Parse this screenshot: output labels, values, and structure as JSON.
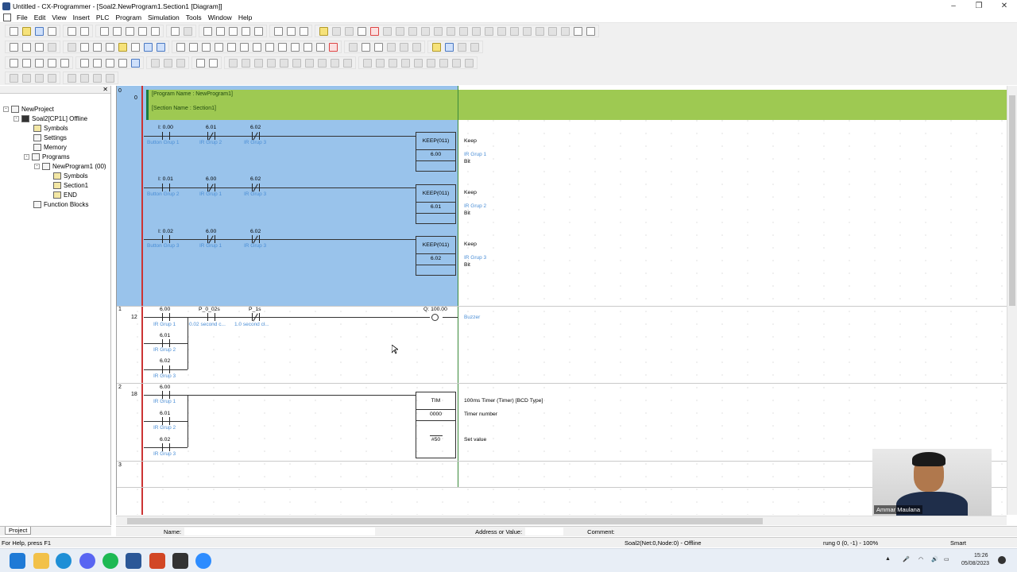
{
  "window": {
    "title": "Untitled - CX-Programmer - [Soal2.NewProgram1.Section1 [Diagram]]",
    "min": "–",
    "max": "❐",
    "close": "✕"
  },
  "menu": [
    "File",
    "Edit",
    "View",
    "Insert",
    "PLC",
    "Program",
    "Simulation",
    "Tools",
    "Window",
    "Help"
  ],
  "tree": {
    "root": "NewProject",
    "plc": "Soal2[CP1L] Offline",
    "symbols": "Symbols",
    "settings": "Settings",
    "memory": "Memory",
    "programs": "Programs",
    "program1": "NewProgram1 (00)",
    "p_symbols": "Symbols",
    "section1": "Section1",
    "end": "END",
    "function_blocks": "Function Blocks",
    "tab": "Project"
  },
  "diagram": {
    "header": {
      "program_name": "[Program Name : NewProgram1]",
      "section_name": "[Section Name : Section1]"
    },
    "rung0": {
      "num": "0",
      "step": "0",
      "rows": [
        {
          "c1": "I: 0.00",
          "c1cmt": "Button Grup 1",
          "c2": "6.01",
          "c2cmt": "IR Grup 2",
          "c3": "6.02",
          "c3cmt": "IR Grup 3",
          "fb": "KEEP(011)",
          "fbval": "6.00",
          "fbtitle": "Keep",
          "fbc1": "IR Grup 1",
          "fbc2": "Bit"
        },
        {
          "c1": "I: 0.01",
          "c1cmt": "Button Grup 2",
          "c2": "6.00",
          "c2cmt": "IR Grup 1",
          "c3": "6.02",
          "c3cmt": "IR Grup 3",
          "fb": "KEEP(011)",
          "fbval": "6.01",
          "fbtitle": "Keep",
          "fbc1": "IR Grup 2",
          "fbc2": "Bit"
        },
        {
          "c1": "I: 0.02",
          "c1cmt": "Button Grup 3",
          "c2": "6.00",
          "c2cmt": "IR Grup 1",
          "c3": "6.02",
          "c3cmt": "IR Grup 3",
          "fb": "KEEP(011)",
          "fbval": "6.02",
          "fbtitle": "Keep",
          "fbc1": "IR Grup 3",
          "fbc2": "Bit"
        }
      ]
    },
    "rung1": {
      "num": "1",
      "step": "12",
      "c1": "6.00",
      "c1cmt": "IR Grup 1",
      "c2": "P_0_02s",
      "c2cmt": "0.02 second c...",
      "c3": "P_1s",
      "c3cmt": "1.0 second cl...",
      "coil": "Q: 100.00",
      "coilcmt": "Buzzer",
      "b1": "6.01",
      "b1cmt": "IR Grup 2",
      "b2": "6.02",
      "b2cmt": "IR Grup 3"
    },
    "rung2": {
      "num": "2",
      "step": "18",
      "c1": "6.00",
      "c1cmt": "IR Grup 1",
      "b1": "6.01",
      "b1cmt": "IR Grup 2",
      "b2": "6.02",
      "b2cmt": "IR Grup 3",
      "fb": "TIM",
      "fbval1": "0000",
      "fbval2": "#50",
      "t1": "100ms Timer (Timer) [BCD Type]",
      "t2": "Timer number",
      "t3": "Set value"
    },
    "rung3": {
      "num": "3"
    }
  },
  "namebar": {
    "name": "Name:",
    "addr": "Address or Value:",
    "comment": "Comment:"
  },
  "status": {
    "help": "For Help, press F1",
    "plc": "Soal2(Net:0,Node:0) - Offline",
    "pos": "rung 0 (0, -1)  - 100%",
    "mode": "Smart"
  },
  "clock": {
    "time": "15:26",
    "date": "05/08/2023"
  },
  "webcam": {
    "name": "Ammar Maulana"
  }
}
